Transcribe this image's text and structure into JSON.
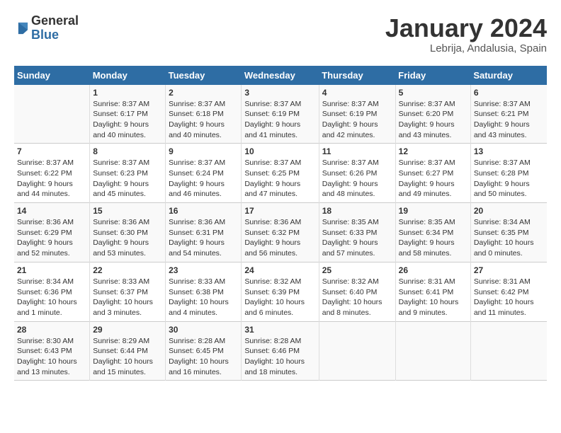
{
  "logo": {
    "general": "General",
    "blue": "Blue"
  },
  "title": "January 2024",
  "location": "Lebrija, Andalusia, Spain",
  "days_of_week": [
    "Sunday",
    "Monday",
    "Tuesday",
    "Wednesday",
    "Thursday",
    "Friday",
    "Saturday"
  ],
  "weeks": [
    [
      {
        "day": "",
        "sunrise": "",
        "sunset": "",
        "daylight": ""
      },
      {
        "day": "1",
        "sunrise": "Sunrise: 8:37 AM",
        "sunset": "Sunset: 6:17 PM",
        "daylight": "Daylight: 9 hours and 40 minutes."
      },
      {
        "day": "2",
        "sunrise": "Sunrise: 8:37 AM",
        "sunset": "Sunset: 6:18 PM",
        "daylight": "Daylight: 9 hours and 40 minutes."
      },
      {
        "day": "3",
        "sunrise": "Sunrise: 8:37 AM",
        "sunset": "Sunset: 6:19 PM",
        "daylight": "Daylight: 9 hours and 41 minutes."
      },
      {
        "day": "4",
        "sunrise": "Sunrise: 8:37 AM",
        "sunset": "Sunset: 6:19 PM",
        "daylight": "Daylight: 9 hours and 42 minutes."
      },
      {
        "day": "5",
        "sunrise": "Sunrise: 8:37 AM",
        "sunset": "Sunset: 6:20 PM",
        "daylight": "Daylight: 9 hours and 43 minutes."
      },
      {
        "day": "6",
        "sunrise": "Sunrise: 8:37 AM",
        "sunset": "Sunset: 6:21 PM",
        "daylight": "Daylight: 9 hours and 43 minutes."
      }
    ],
    [
      {
        "day": "7",
        "sunrise": "Sunrise: 8:37 AM",
        "sunset": "Sunset: 6:22 PM",
        "daylight": "Daylight: 9 hours and 44 minutes."
      },
      {
        "day": "8",
        "sunrise": "Sunrise: 8:37 AM",
        "sunset": "Sunset: 6:23 PM",
        "daylight": "Daylight: 9 hours and 45 minutes."
      },
      {
        "day": "9",
        "sunrise": "Sunrise: 8:37 AM",
        "sunset": "Sunset: 6:24 PM",
        "daylight": "Daylight: 9 hours and 46 minutes."
      },
      {
        "day": "10",
        "sunrise": "Sunrise: 8:37 AM",
        "sunset": "Sunset: 6:25 PM",
        "daylight": "Daylight: 9 hours and 47 minutes."
      },
      {
        "day": "11",
        "sunrise": "Sunrise: 8:37 AM",
        "sunset": "Sunset: 6:26 PM",
        "daylight": "Daylight: 9 hours and 48 minutes."
      },
      {
        "day": "12",
        "sunrise": "Sunrise: 8:37 AM",
        "sunset": "Sunset: 6:27 PM",
        "daylight": "Daylight: 9 hours and 49 minutes."
      },
      {
        "day": "13",
        "sunrise": "Sunrise: 8:37 AM",
        "sunset": "Sunset: 6:28 PM",
        "daylight": "Daylight: 9 hours and 50 minutes."
      }
    ],
    [
      {
        "day": "14",
        "sunrise": "Sunrise: 8:36 AM",
        "sunset": "Sunset: 6:29 PM",
        "daylight": "Daylight: 9 hours and 52 minutes."
      },
      {
        "day": "15",
        "sunrise": "Sunrise: 8:36 AM",
        "sunset": "Sunset: 6:30 PM",
        "daylight": "Daylight: 9 hours and 53 minutes."
      },
      {
        "day": "16",
        "sunrise": "Sunrise: 8:36 AM",
        "sunset": "Sunset: 6:31 PM",
        "daylight": "Daylight: 9 hours and 54 minutes."
      },
      {
        "day": "17",
        "sunrise": "Sunrise: 8:36 AM",
        "sunset": "Sunset: 6:32 PM",
        "daylight": "Daylight: 9 hours and 56 minutes."
      },
      {
        "day": "18",
        "sunrise": "Sunrise: 8:35 AM",
        "sunset": "Sunset: 6:33 PM",
        "daylight": "Daylight: 9 hours and 57 minutes."
      },
      {
        "day": "19",
        "sunrise": "Sunrise: 8:35 AM",
        "sunset": "Sunset: 6:34 PM",
        "daylight": "Daylight: 9 hours and 58 minutes."
      },
      {
        "day": "20",
        "sunrise": "Sunrise: 8:34 AM",
        "sunset": "Sunset: 6:35 PM",
        "daylight": "Daylight: 10 hours and 0 minutes."
      }
    ],
    [
      {
        "day": "21",
        "sunrise": "Sunrise: 8:34 AM",
        "sunset": "Sunset: 6:36 PM",
        "daylight": "Daylight: 10 hours and 1 minute."
      },
      {
        "day": "22",
        "sunrise": "Sunrise: 8:33 AM",
        "sunset": "Sunset: 6:37 PM",
        "daylight": "Daylight: 10 hours and 3 minutes."
      },
      {
        "day": "23",
        "sunrise": "Sunrise: 8:33 AM",
        "sunset": "Sunset: 6:38 PM",
        "daylight": "Daylight: 10 hours and 4 minutes."
      },
      {
        "day": "24",
        "sunrise": "Sunrise: 8:32 AM",
        "sunset": "Sunset: 6:39 PM",
        "daylight": "Daylight: 10 hours and 6 minutes."
      },
      {
        "day": "25",
        "sunrise": "Sunrise: 8:32 AM",
        "sunset": "Sunset: 6:40 PM",
        "daylight": "Daylight: 10 hours and 8 minutes."
      },
      {
        "day": "26",
        "sunrise": "Sunrise: 8:31 AM",
        "sunset": "Sunset: 6:41 PM",
        "daylight": "Daylight: 10 hours and 9 minutes."
      },
      {
        "day": "27",
        "sunrise": "Sunrise: 8:31 AM",
        "sunset": "Sunset: 6:42 PM",
        "daylight": "Daylight: 10 hours and 11 minutes."
      }
    ],
    [
      {
        "day": "28",
        "sunrise": "Sunrise: 8:30 AM",
        "sunset": "Sunset: 6:43 PM",
        "daylight": "Daylight: 10 hours and 13 minutes."
      },
      {
        "day": "29",
        "sunrise": "Sunrise: 8:29 AM",
        "sunset": "Sunset: 6:44 PM",
        "daylight": "Daylight: 10 hours and 15 minutes."
      },
      {
        "day": "30",
        "sunrise": "Sunrise: 8:28 AM",
        "sunset": "Sunset: 6:45 PM",
        "daylight": "Daylight: 10 hours and 16 minutes."
      },
      {
        "day": "31",
        "sunrise": "Sunrise: 8:28 AM",
        "sunset": "Sunset: 6:46 PM",
        "daylight": "Daylight: 10 hours and 18 minutes."
      },
      {
        "day": "",
        "sunrise": "",
        "sunset": "",
        "daylight": ""
      },
      {
        "day": "",
        "sunrise": "",
        "sunset": "",
        "daylight": ""
      },
      {
        "day": "",
        "sunrise": "",
        "sunset": "",
        "daylight": ""
      }
    ]
  ]
}
